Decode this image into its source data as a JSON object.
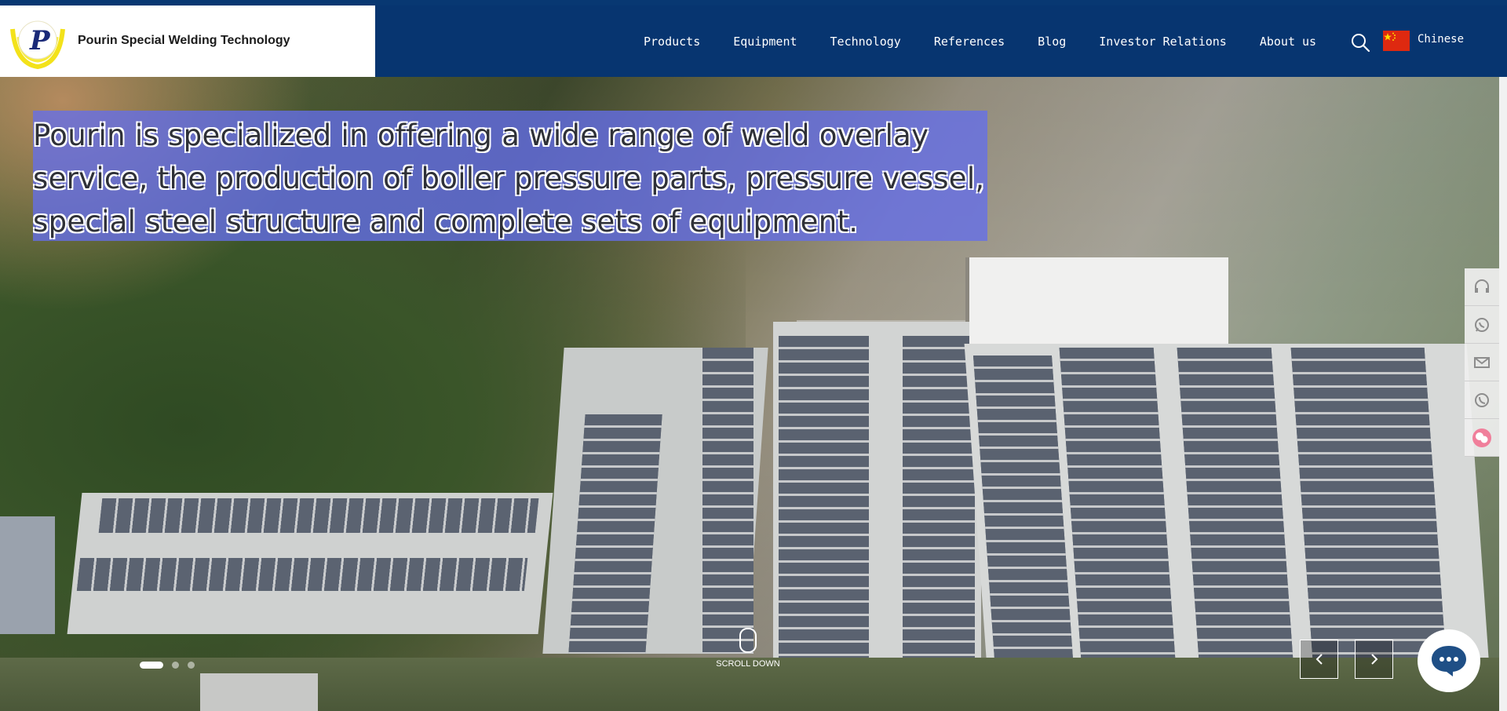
{
  "brand": {
    "name": "Pourin Special Welding Technology",
    "logo_letter": "P"
  },
  "nav": {
    "items": [
      "Products",
      "Equipment",
      "Technology",
      "References",
      "Blog",
      "Investor Relations",
      "About us"
    ],
    "language_label": "Chinese"
  },
  "hero": {
    "headline": "Pourin is specialized in offering a wide range of weld overlay service, the production of boiler pressure parts, pressure vessel, special steel structure and complete sets of equipment.",
    "scroll_label": "SCROLL DOWN",
    "slides_total": 3,
    "slide_active": 1
  },
  "sidebar": {
    "icons": [
      "headset-icon",
      "whatsapp-icon",
      "mail-icon",
      "phone-icon",
      "wechat-icon"
    ]
  },
  "colors": {
    "header_bg": "#073570",
    "headline_bg": "#6470eb",
    "flag_red": "#de2910"
  }
}
